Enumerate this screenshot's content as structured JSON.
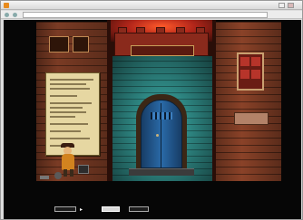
{
  "window": {
    "title": "",
    "address": ""
  },
  "scene": {
    "tower_subtitle": "",
    "notice_lines": [
      "",
      "",
      "",
      "",
      "",
      "",
      "",
      "",
      "",
      "",
      "",
      ""
    ]
  },
  "bottom_bar": {
    "left_button": "",
    "middle_button": "",
    "right_button": "",
    "arrow": "▸"
  },
  "colors": {
    "brick": "#7a3b24",
    "tower": "#2f8a86",
    "door": "#2a6aa8",
    "glow": "#ff5a2a"
  },
  "icons": [
    "browser-icon",
    "back-icon",
    "forward-icon",
    "minimize-icon",
    "close-icon"
  ]
}
